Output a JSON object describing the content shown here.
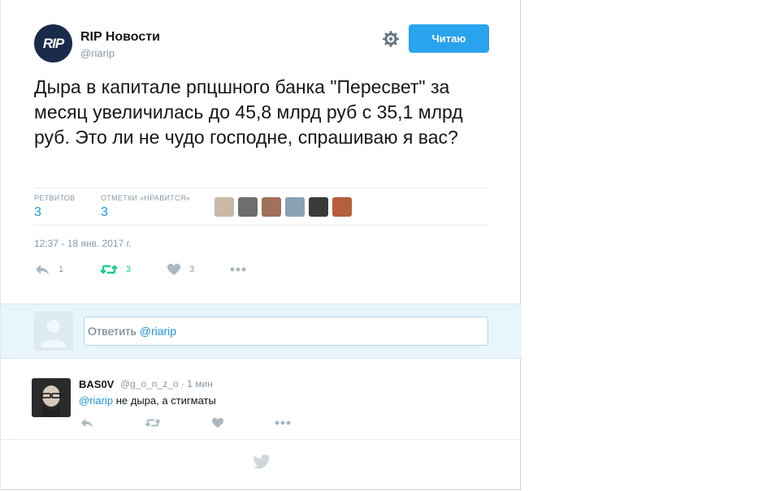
{
  "tweet": {
    "author_name": "RIP Новости",
    "author_handle": "@riarip",
    "avatar_text": "RIP",
    "follow_label": "Читаю",
    "text": "Дыра в капитале рпцшного банка \"Пересвет\" за месяц увеличилась до 45,8 млрд руб с 35,1 млрд руб. Это ли не чудо господне, спрашиваю я вас?",
    "stats": {
      "retweets_label": "РЕТВИТОВ",
      "retweets_value": "3",
      "likes_label": "ОТМЕТКИ «НРАВИТСЯ»",
      "likes_value": "3"
    },
    "liker_avatars": [
      "#c9b8a8",
      "#6e6e6e",
      "#a0705a",
      "#8aa0b5",
      "#3a3a3a",
      "#b5603a"
    ],
    "timestamp": "12:37 - 18 янв. 2017 г.",
    "actions": {
      "reply_count": "1",
      "retweet_count": "3",
      "like_count": "3"
    }
  },
  "reply_box": {
    "prefix": "Ответить",
    "mention": "@riarip"
  },
  "reply": {
    "author_name": "BAS0V",
    "meta": "@g_o_n_z_o · 1 мин",
    "mention": "@riarip",
    "text": "не дыра, а стигматы"
  },
  "colors": {
    "accent": "#1b95e0",
    "follow": "#2aa3ef",
    "retweet_green": "#19cf86",
    "muted": "#8899a6",
    "reply_area": "#e8f5fd"
  },
  "icons": [
    "gear-icon",
    "reply-icon",
    "retweet-icon",
    "heart-icon",
    "more-icon",
    "twitter-bird-icon"
  ]
}
